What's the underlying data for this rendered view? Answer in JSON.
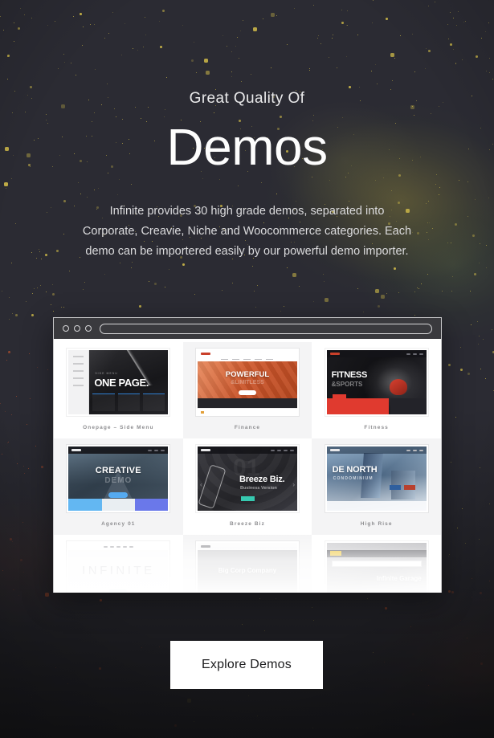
{
  "hero": {
    "eyebrow": "Great Quality Of",
    "headline": "Demos",
    "description": "Infinite provides 30 high grade demos, separated into Corporate, Creavie, Niche and Woocommerce categories. Each demo can be importered easily by our powerful demo importer."
  },
  "browser": {
    "address_value": "",
    "address_placeholder": "",
    "traffic_lights": [
      "close-dot",
      "minimize-dot",
      "zoom-dot"
    ]
  },
  "demos": [
    {
      "caption": "Onepage – Side Menu",
      "title": "ONE PAGE.",
      "kicker": "SIDE MENU"
    },
    {
      "caption": "Finance",
      "title": "POWERFUL",
      "kicker": "&LIMITLESS"
    },
    {
      "caption": "Fitness",
      "title": "FITNESS",
      "kicker": "&SPORTS"
    },
    {
      "caption": "Agency 01",
      "title": "CREATIVE",
      "kicker": "DEMO"
    },
    {
      "caption": "Breeze Biz",
      "title": "Breeze Biz.",
      "kicker": "Business Version"
    },
    {
      "caption": "High Rise",
      "title": "DE NORTH",
      "kicker": "CONDOMINIUM"
    },
    {
      "caption": "",
      "title": "INFINITE",
      "kicker": ""
    },
    {
      "caption": "",
      "title": "Big Corp Company",
      "kicker": ""
    },
    {
      "caption": "",
      "title": "Infinite Garage",
      "kicker": ""
    }
  ],
  "cta": {
    "label": "Explore Demos"
  },
  "colors": {
    "background": "#2b2b33",
    "headline": "#fdfdfd",
    "body_text": "#dcdcde",
    "cta_background": "#ffffff",
    "cta_text": "#1c1c1e",
    "caption_text": "#8d8d90",
    "accent_orange": "#c9542a",
    "accent_red": "#e03a2f",
    "accent_blue": "#55aaf0",
    "accent_teal": "#36c9b0",
    "star_gold": "#d8c24a",
    "star_warm": "#b5502e"
  }
}
